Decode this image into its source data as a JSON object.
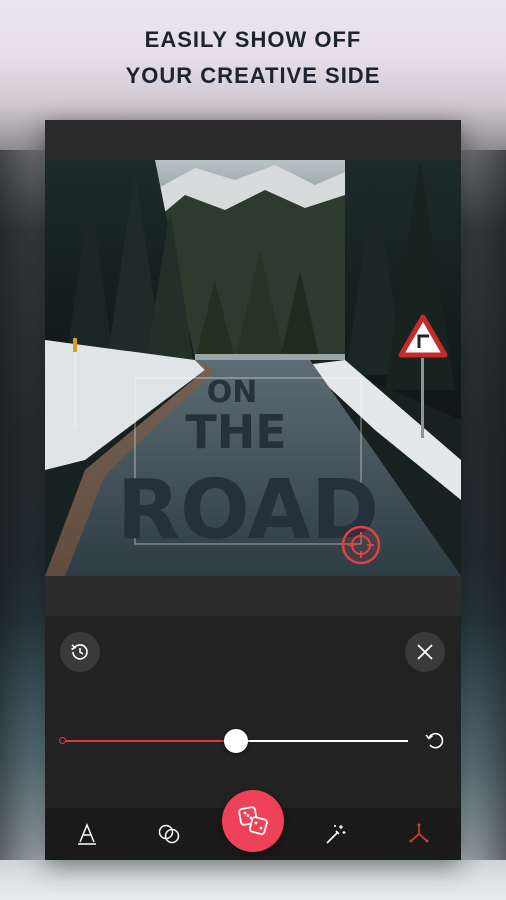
{
  "headline": {
    "line1": "EASILY SHOW OFF",
    "line2": "YOUR CREATIVE SIDE"
  },
  "photo": {
    "overlay_text": {
      "line1": "ON",
      "line2": "THE",
      "line3": "ROAD"
    }
  },
  "editor": {
    "slider": {
      "value_fraction": 0.5
    }
  },
  "icons": {
    "history": "history-icon",
    "close": "close-icon",
    "reset": "reset-icon",
    "transform_handle": "move-rotate-handle-icon",
    "text_tool": "text-icon",
    "blend_tool": "blend-icon",
    "dice": "dice-icon",
    "magic_tool": "magic-wand-icon",
    "adjust_tool": "adjust-icon"
  },
  "colors": {
    "accent": "#ef4258",
    "slider_fill": "#e0383e",
    "headline": "#1d2430",
    "panel": "#222222",
    "bottom_bar": "#1a1a1a"
  }
}
